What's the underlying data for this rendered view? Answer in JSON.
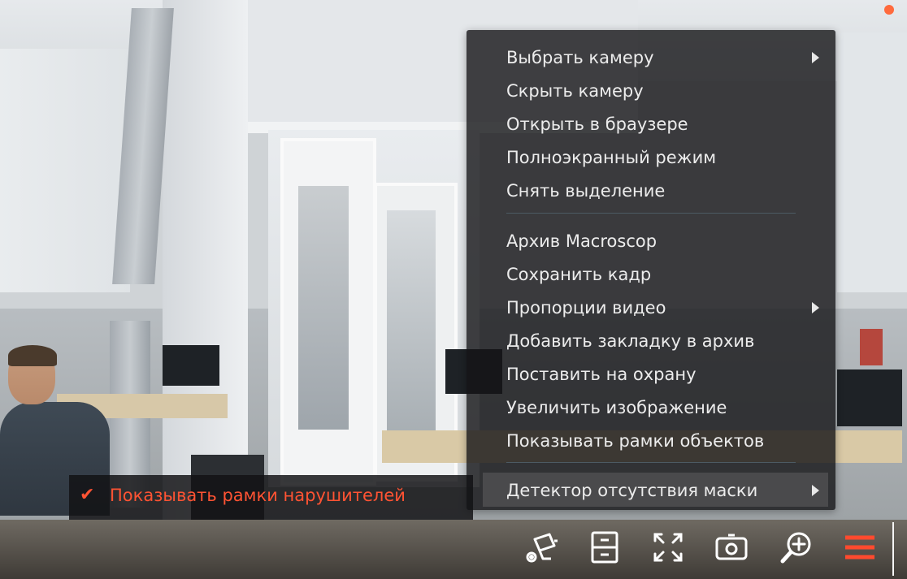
{
  "menu": {
    "items": [
      {
        "label": "Выбрать камеру",
        "has_submenu": true
      },
      {
        "label": "Скрыть камеру"
      },
      {
        "label": "Открыть в браузере"
      },
      {
        "label": "Полноэкранный режим"
      },
      {
        "label": "Снять выделение"
      },
      {
        "label": "Архив Macroscop"
      },
      {
        "label": "Сохранить кадр"
      },
      {
        "label": "Пропорции видео",
        "has_submenu": true
      },
      {
        "label": "Добавить закладку в архив"
      },
      {
        "label": "Поставить на охрану"
      },
      {
        "label": "Увеличить изображение"
      },
      {
        "label": "Показывать рамки объектов"
      },
      {
        "label": "Детектор отсутствия маски",
        "has_submenu": true,
        "highlighted": true
      }
    ]
  },
  "submenu": {
    "check_glyph": "✔",
    "item_label": "Показывать рамки нарушителей",
    "checked": true,
    "color": "#ff5333"
  },
  "toolbar": {
    "icons": [
      "camera-settings-icon",
      "archive-icon",
      "fullscreen-icon",
      "snapshot-icon",
      "zoom-in-icon",
      "menu-icon"
    ],
    "accent_color": "#ff4a2e"
  }
}
